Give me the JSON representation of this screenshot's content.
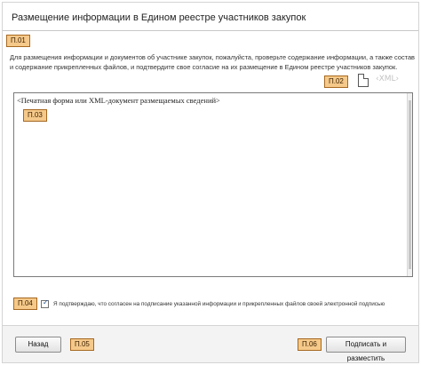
{
  "dialog": {
    "title": "Размещение информации в Едином реестре участников закупок"
  },
  "markers": {
    "p01": "П.01",
    "p02": "П.02",
    "p03": "П.03",
    "p04": "П.04",
    "p05": "П.05",
    "p06": "П.06"
  },
  "description": "Для размещения информации и документов об участнике закупок, пожалуйста, проверьте содержание информации, а также состав и содержание прикрепленных файлов, и подтвердите свое согласие на их размещение в Едином реестре участников закупок.",
  "icons": {
    "document": "document-icon",
    "xml": "xml-icon",
    "xml_text": "‹XML›"
  },
  "preview": {
    "placeholder": "<Печатная форма или XML-документ размещаемых сведений>"
  },
  "consent": {
    "checked": true,
    "text": "Я подтверждаю, что согласен на подписание указанной информации и прикрепленных файлов своей электронной подписью"
  },
  "footer": {
    "back_label": "Назад",
    "sign_label": "Подписать и разместить"
  }
}
